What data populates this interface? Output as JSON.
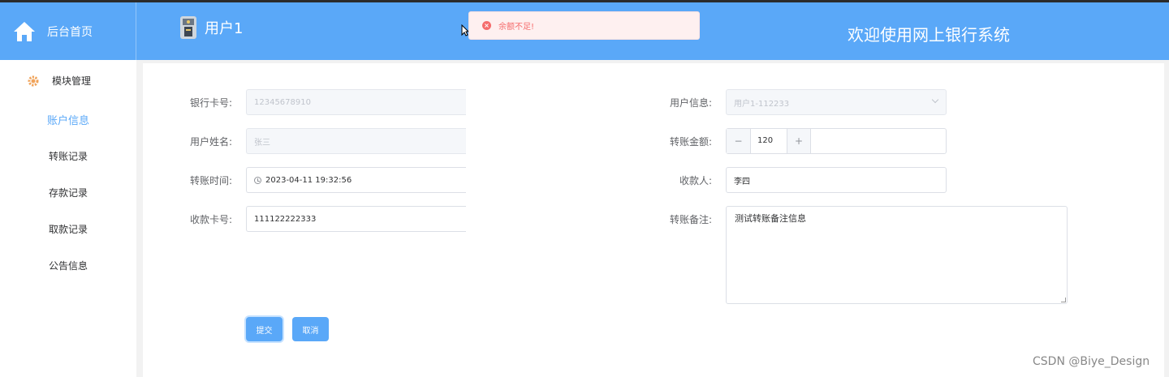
{
  "header": {
    "home_label": "后台首页",
    "user_name": "用户1",
    "welcome": "欢迎使用网上银行系统"
  },
  "toast": {
    "message": "余额不足!",
    "type": "error"
  },
  "sidebar": {
    "section_label": "模块管理",
    "items": [
      {
        "label": "账户信息",
        "active": true
      },
      {
        "label": "转账记录"
      },
      {
        "label": "存款记录"
      },
      {
        "label": "取款记录"
      },
      {
        "label": "公告信息"
      }
    ]
  },
  "form": {
    "card_no": {
      "label": "银行卡号:",
      "value": "12345678910"
    },
    "user_info": {
      "label": "用户信息:",
      "value": "用户1-112233"
    },
    "user_name": {
      "label": "用户姓名:",
      "value": "张三"
    },
    "amount": {
      "label": "转账金额:",
      "value": "120",
      "minus": "−",
      "plus": "+"
    },
    "time": {
      "label": "转账时间:",
      "value": "2023-04-11 19:32:56"
    },
    "payee": {
      "label": "收款人:",
      "value": "李四"
    },
    "payee_card": {
      "label": "收款卡号:",
      "value": "111122222333"
    },
    "remark": {
      "label": "转账备注:",
      "value": "测试转账备注信息"
    },
    "submit_label": "提交",
    "cancel_label": "取消"
  },
  "watermark": "CSDN @Biye_Design",
  "colors": {
    "primary": "#5aa8f8",
    "error": "#f56c6c",
    "error_bg": "#fef0f0"
  }
}
